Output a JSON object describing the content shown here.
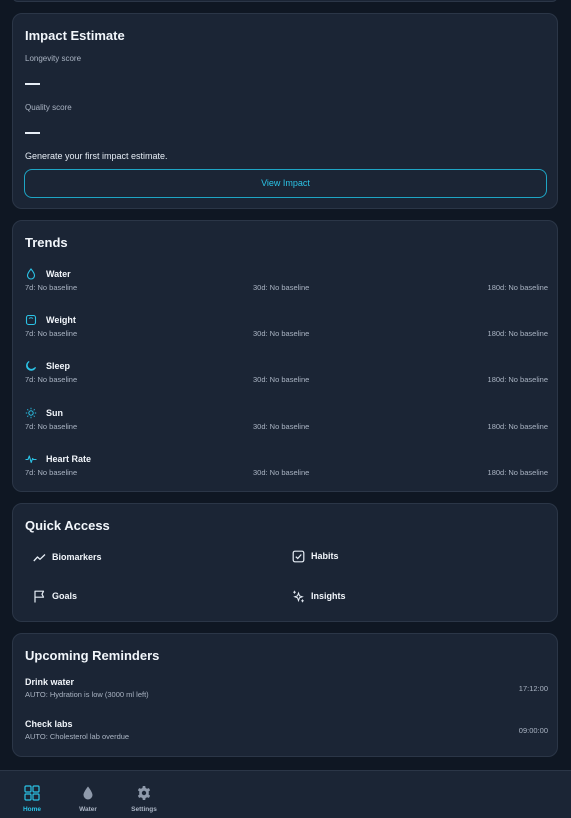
{
  "impact": {
    "title": "Impact Estimate",
    "longevity_label": "Longevity score",
    "quality_label": "Quality score",
    "hint": "Generate your first impact estimate.",
    "button_label": "View Impact"
  },
  "trends": {
    "title": "Trends",
    "items": [
      {
        "name": "Water",
        "icon": "water-drop-icon",
        "d7": "7d: No baseline",
        "d30": "30d: No baseline",
        "d180": "180d: No baseline"
      },
      {
        "name": "Weight",
        "icon": "scale-icon",
        "d7": "7d: No baseline",
        "d30": "30d: No baseline",
        "d180": "180d: No baseline"
      },
      {
        "name": "Sleep",
        "icon": "moon-icon",
        "d7": "7d: No baseline",
        "d30": "30d: No baseline",
        "d180": "180d: No baseline"
      },
      {
        "name": "Sun",
        "icon": "sun-icon",
        "d7": "7d: No baseline",
        "d30": "30d: No baseline",
        "d180": "180d: No baseline"
      },
      {
        "name": "Heart Rate",
        "icon": "heart-rate-icon",
        "d7": "7d: No baseline",
        "d30": "30d: No baseline",
        "d180": "180d: No baseline"
      }
    ]
  },
  "quick_access": {
    "title": "Quick Access",
    "items": [
      {
        "label": "Biomarkers",
        "icon": "trend-line-icon"
      },
      {
        "label": "Habits",
        "icon": "checkbox-icon"
      },
      {
        "label": "Goals",
        "icon": "flag-icon"
      },
      {
        "label": "Insights",
        "icon": "sparkles-icon"
      }
    ]
  },
  "reminders": {
    "title": "Upcoming Reminders",
    "items": [
      {
        "title": "Drink water",
        "detail": "AUTO: Hydration is low (3000 ml left)",
        "time": "17:12:00"
      },
      {
        "title": "Check labs",
        "detail": "AUTO: Cholesterol lab overdue",
        "time": "09:00:00"
      }
    ]
  },
  "nav": {
    "items": [
      {
        "label": "Home",
        "icon": "grid-icon",
        "active": true
      },
      {
        "label": "Water",
        "icon": "water-drop-icon",
        "active": false
      },
      {
        "label": "Settings",
        "icon": "gear-icon",
        "active": false
      }
    ]
  },
  "colors": {
    "accent": "#2bc3e6",
    "background": "#0f1723",
    "card": "#1b2535"
  }
}
